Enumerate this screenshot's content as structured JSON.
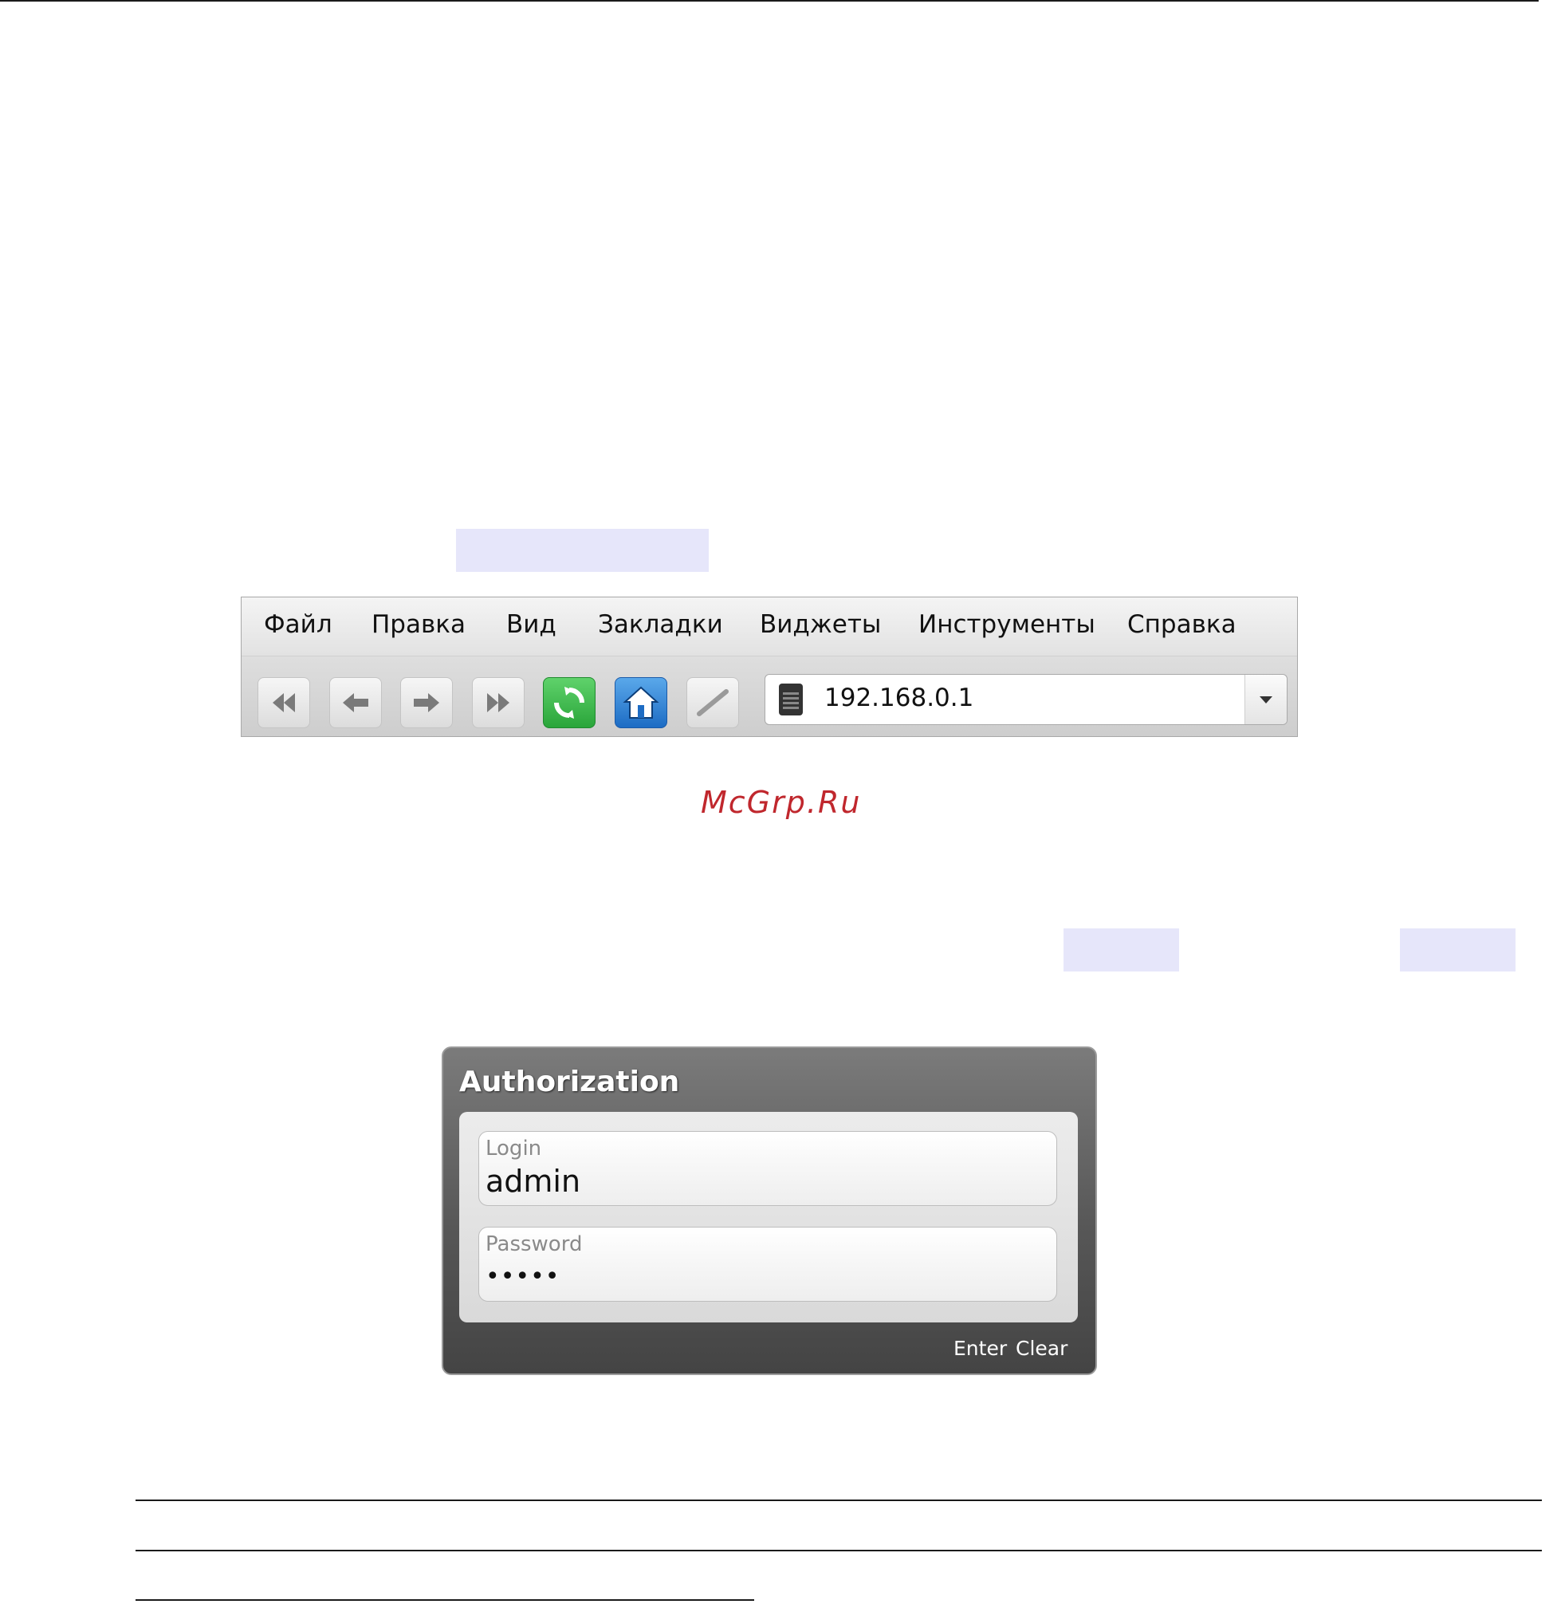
{
  "browser": {
    "menu": [
      "Файл",
      "Правка",
      "Вид",
      "Закладки",
      "Виджеты",
      "Инструменты",
      "Справка"
    ],
    "toolbar_icons": [
      "rewind-icon",
      "back-arrow-icon",
      "forward-arrow-icon",
      "fast-forward-icon",
      "reload-icon",
      "home-icon",
      "edit-pen-icon"
    ],
    "address": "192.168.0.1"
  },
  "watermark": "McGrp.Ru",
  "auth": {
    "title": "Authorization",
    "login_label": "Login",
    "login_value": "admin",
    "password_label": "Password",
    "password_value": "•••••",
    "enter_label": "Enter",
    "clear_label": "Clear"
  },
  "colors": {
    "highlight": "#e6e6fa",
    "watermark": "#c0272d",
    "reload_button": "#2aa53a",
    "home_button": "#1d6cc4"
  }
}
